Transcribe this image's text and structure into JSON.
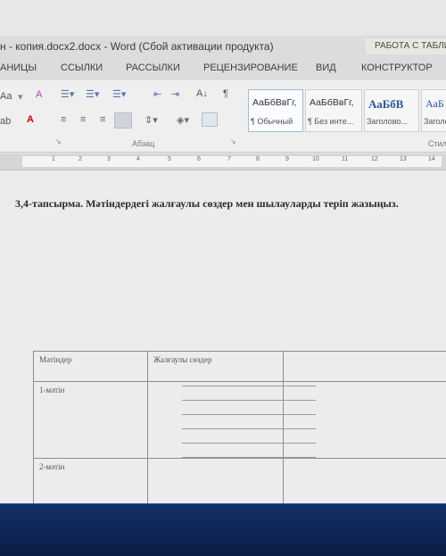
{
  "titlebar": {
    "document_title": "н - копия.docx2.docx - Word (Сбой активации продукта)",
    "context_tab": "РАБОТА С ТАБЛИ"
  },
  "tabs": [
    "АНИЦЫ",
    "ССЫЛКИ",
    "РАССЫЛКИ",
    "РЕЦЕНЗИРОВАНИЕ",
    "ВИД",
    "КОНСТРУКТОР"
  ],
  "ribbon": {
    "font_case": "Aa",
    "styles": [
      {
        "sample": "АаБбВвГг,",
        "name": "¶ Обычный"
      },
      {
        "sample": "АаБбВвГг,",
        "name": "¶ Без инте..."
      },
      {
        "sample": "АаБбВ",
        "name": "Заголово..."
      },
      {
        "sample": "АаБ",
        "name": "Заголо"
      }
    ],
    "groups": {
      "paragraph": "Абзац",
      "styles": "Стил"
    }
  },
  "ruler": {
    "ticks": [
      "1",
      "2",
      "3",
      "4",
      "5",
      "6",
      "7",
      "8",
      "9",
      "10",
      "11",
      "12",
      "13",
      "14"
    ]
  },
  "document": {
    "heading": "3,4-тапсырма. Мәтіндердегі жалғаулы сөздер мен шылауларды теріп жазыңыз.",
    "table": {
      "headers": [
        "Мәтіндер",
        "Жалғаулы сөздер",
        ""
      ],
      "rows": [
        {
          "text": "1-мәтін"
        },
        {
          "text": "2-мәтін"
        }
      ]
    }
  },
  "colors": {
    "accent": "#2b579a",
    "taskbar": "#13306a"
  }
}
